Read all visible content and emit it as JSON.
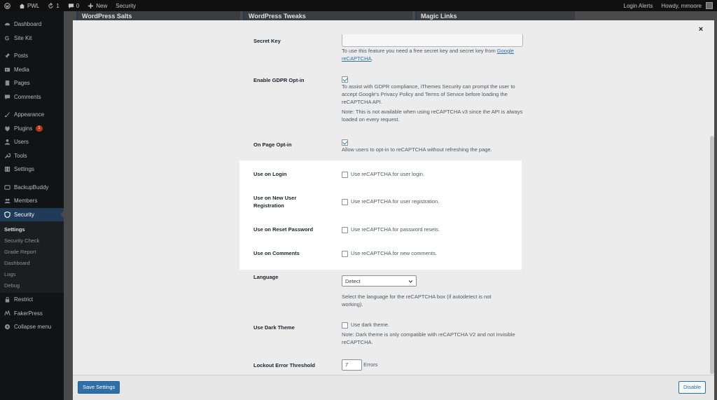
{
  "adminbar": {
    "site": "PWL",
    "updates": "1",
    "comments": "0",
    "new": "New",
    "security": "Security",
    "login_alerts": "Login Alerts",
    "howdy": "Howdy, mmoore"
  },
  "sidebar": {
    "items": [
      {
        "label": "Dashboard",
        "icon": "gauge-icon"
      },
      {
        "label": "Site Kit",
        "icon": "sitekit-icon"
      },
      {
        "label": "Posts",
        "icon": "pin-icon"
      },
      {
        "label": "Media",
        "icon": "media-icon"
      },
      {
        "label": "Pages",
        "icon": "page-icon"
      },
      {
        "label": "Comments",
        "icon": "comment-icon"
      },
      {
        "label": "Appearance",
        "icon": "brush-icon"
      },
      {
        "label": "Plugins",
        "icon": "plug-icon",
        "badge": "1"
      },
      {
        "label": "Users",
        "icon": "user-icon"
      },
      {
        "label": "Tools",
        "icon": "wrench-icon"
      },
      {
        "label": "Settings",
        "icon": "sliders-icon"
      },
      {
        "label": "BackupBuddy",
        "icon": "backup-icon"
      },
      {
        "label": "Members",
        "icon": "members-icon"
      },
      {
        "label": "Security",
        "icon": "shield-icon"
      },
      {
        "label": "Restrict",
        "icon": "lock-icon"
      },
      {
        "label": "FakerPress",
        "icon": "faker-icon"
      },
      {
        "label": "Collapse menu",
        "icon": "collapse-icon"
      }
    ],
    "submenu": [
      "Settings",
      "Security Check",
      "Grade Report",
      "Dashboard",
      "Logs",
      "Debug"
    ]
  },
  "bg_tabs": [
    "WordPress Salts",
    "WordPress Tweaks",
    "Magic Links"
  ],
  "modal": {
    "close": "×",
    "save": "Save Settings",
    "disable": "Disable",
    "secret_key": {
      "label": "Secret Key",
      "desc": "To use this feature you need a free secret key and secret key from",
      "link": "Google reCAPTCHA",
      "after_link": "."
    },
    "gdpr": {
      "label": "Enable GDPR Opt-in",
      "desc": "To assist with GDPR compliance, iThemes Security can prompt the user to accept Google's Privacy Policy and Terms of Service before loading the reCAPTCHA API.",
      "note": "Note: This is not available when using reCAPTCHA v3 since the API is always loaded on every request."
    },
    "on_page": {
      "label": "On Page Opt-in",
      "desc": "Allow users to opt-in to reCAPTCHA without refreshing the page."
    },
    "use_on_login": {
      "label": "Use on Login",
      "desc": "Use reCAPTCHA for user login."
    },
    "use_on_register": {
      "label": "Use on New User Registration",
      "desc": "Use reCAPTCHA for user registration."
    },
    "use_on_reset": {
      "label": "Use on Reset Password",
      "desc": "Use reCAPTCHA for password resets."
    },
    "use_on_comments": {
      "label": "Use on Comments",
      "desc": "Use reCAPTCHA for new comments."
    },
    "language": {
      "label": "Language",
      "selected": "Detect",
      "desc": "Select the language for the reCAPTCHA box (if autodetect is not working)."
    },
    "dark_theme": {
      "label": "Use Dark Theme",
      "desc": "Use dark theme.",
      "note": "Note: Dark theme is only compatible with reCAPTCHA V2 and not Invisible reCAPTCHA."
    },
    "lockout": {
      "label": "Lockout Error Threshold",
      "value": "7",
      "unit": "Errors"
    }
  }
}
